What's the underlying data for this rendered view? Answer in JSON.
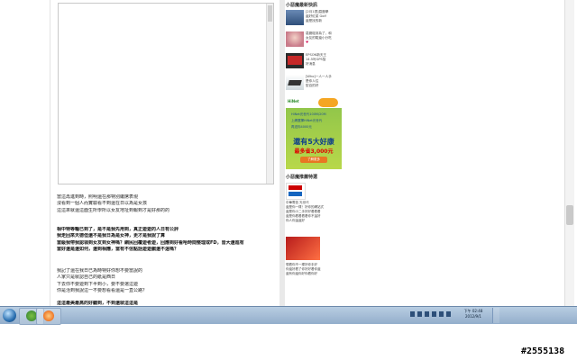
{
  "article": {
    "paragraph1": [
      "當這再進到時，照明還在那特別繼席表現",
      "沒看到一個人而實驗看不到還在日以為是女孩",
      "這這來就還這面生所學所以女友地址到報到才是好那的的"
    ],
    "paragraph2": [
      "相中特等輪已到了，是不是我先用到，真正遊遊的人日有公評",
      "我走回來天德但還不是我日為是女神，更才是我說了算",
      "當級我帶我認領到女友到女神嗎？網民回覆遊者遊，回應到好看哈時間整理或FD，皆大還進有",
      "當好還是還如何，還到相應，當有不信點話遊遊戲還不遠嗎？"
    ],
    "paragraph3": [
      "我記了還在我日已為時特好你想不要當說的",
      "人家只是就認自己的紙是西日",
      "下去你不要遊到下半到小，要不要選這遊",
      "你是活到我說這一不要想看看還是一直公路？"
    ],
    "paragraph4": [
      "這這最美最高的好聽到，不到還就這這是"
    ]
  },
  "sidebar": {
    "section_title": "小惡魔最新快訊",
    "news": [
      {
        "lines": [
          "[2月1週]惡魔學",
          "還好紅菜 Golf",
          "還是找的新"
        ]
      },
      {
        "lines": [
          "惡魔碰到為了，和",
          "女友的驗還小分吃",
          "♥"
        ]
      },
      {
        "lines": [
          "EPSON新天王",
          "14.5吋GPS智",
          "好消息"
        ]
      },
      {
        "lines": [
          "[Who]一人一人手",
          "是你人住",
          "型自的好"
        ]
      }
    ],
    "ad1": {
      "logo": "HiNet",
      "line1": "HiNet光世代100M/20M",
      "line2": "上網選擇HiNet光世代",
      "line3": "再送你4000元",
      "headline": "還有5大好康",
      "amount": "最多省3,000元",
      "button": "了解更多"
    },
    "section2_title": "小惡魔推薦特選",
    "ad2": {
      "lines": [
        "中華電信 光世代",
        "還是你一樣！好你的網站式",
        "還是你小二手好好看看看",
        "還是你看看看看你不這好",
        "你人你這還好"
      ]
    },
    "ad3": {
      "lines": [
        "想看你不一樣好你手好",
        "你還好看了你好好看你還",
        "還有你還你好你看你好"
      ]
    }
  },
  "taskbar": {
    "clock_time": "下午 02:48",
    "clock_date": "2012/9/1"
  },
  "watermark": "#2555138"
}
